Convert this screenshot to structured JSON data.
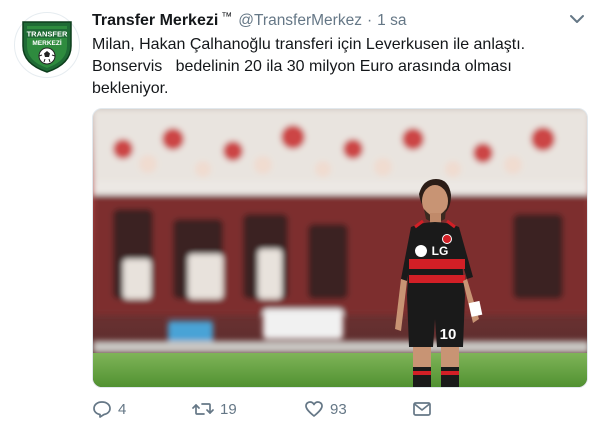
{
  "tweet": {
    "display_name": "Transfer Merkezi",
    "verified_mark": "™",
    "handle": "@TransferMerkez",
    "separator": "·",
    "time": "1 sa",
    "text": "Milan, Hakan Çalhanoğlu transferi için Leverkusen ile anlaştı.\nBonservis   bedelinin 20 ila 30 milyon Euro arasında olması\nbekleniyor.",
    "avatar": {
      "logo_line1": "TRANSFER",
      "logo_line2": "MERKEZİ",
      "colors": {
        "outer": "#1f6b35",
        "inner": "#2e8b3e",
        "text": "#ffffff"
      }
    },
    "media": {
      "jersey_brand": "LG",
      "jersey_number": "10",
      "colors": {
        "jersey_red": "#d21f26",
        "jersey_black": "#1a1a1a",
        "pitch": "#5d9e3a"
      }
    },
    "actions": {
      "reply_count": "4",
      "retweet_count": "19",
      "like_count": "93"
    },
    "icons": [
      "caret-down-icon",
      "reply-icon",
      "retweet-icon",
      "like-icon",
      "direct-message-icon"
    ]
  }
}
